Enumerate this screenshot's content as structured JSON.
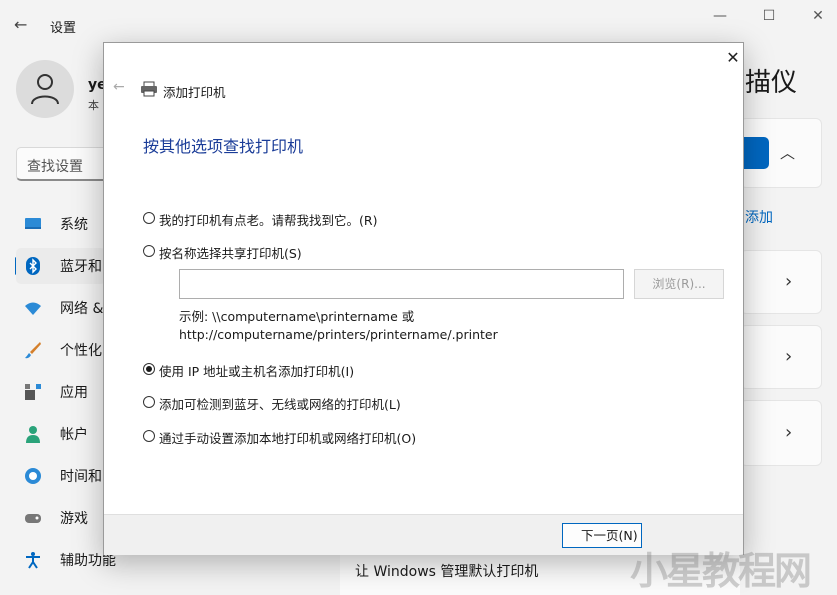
{
  "settings": {
    "title": "设置",
    "user_name": "ye",
    "user_sub": "本",
    "search_placeholder": "查找设置",
    "nav": [
      {
        "label": "系统",
        "icon": "monitor-icon"
      },
      {
        "label": "蓝牙和",
        "icon": "bluetooth-icon"
      },
      {
        "label": "网络 &",
        "icon": "wifi-icon"
      },
      {
        "label": "个性化",
        "icon": "brush-icon"
      },
      {
        "label": "应用",
        "icon": "apps-icon"
      },
      {
        "label": "帐户",
        "icon": "person-icon"
      },
      {
        "label": "时间和",
        "icon": "clock-globe-icon"
      },
      {
        "label": "游戏",
        "icon": "gamepad-icon"
      },
      {
        "label": "辅助功能",
        "icon": "accessibility-icon"
      }
    ],
    "page_title_fragment": "描仪",
    "add_link_fragment": "添加",
    "bottom_setting": "让 Windows 管理默认打印机",
    "window_controls": {
      "minimize": "—",
      "maximize": "☐",
      "close": "✕"
    }
  },
  "dialog": {
    "caption": "添加打印机",
    "heading": "按其他选项查找打印机",
    "options": [
      {
        "label": "我的打印机有点老。请帮我找到它。(R)",
        "checked": false
      },
      {
        "label": "按名称选择共享打印机(S)",
        "checked": false
      },
      {
        "label": "使用 IP 地址或主机名添加打印机(I)",
        "checked": true
      },
      {
        "label": "添加可检测到蓝牙、无线或网络的打印机(L)",
        "checked": false
      },
      {
        "label": "通过手动设置添加本地打印机或网络打印机(O)",
        "checked": false
      }
    ],
    "share_input_value": "",
    "browse_label": "浏览(R)...",
    "example_line1": "示例: \\\\computername\\printername 或",
    "example_line2": "http://computername/printers/printername/.printer",
    "next_label": "下一页(N)",
    "close_glyph": "✕",
    "back_glyph": "←"
  },
  "watermark": "小星教程网"
}
